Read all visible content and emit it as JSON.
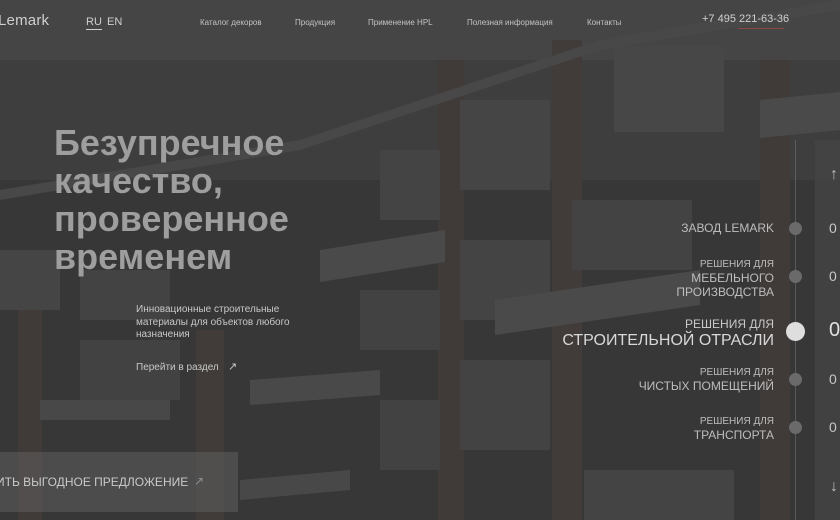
{
  "header": {
    "logo": "Lemark",
    "lang_active": "RU",
    "lang_other": "EN",
    "nav": [
      "Каталог декоров",
      "Продукция",
      "Применение HPL",
      "Полезная информация",
      "Контакты"
    ],
    "phone": "+7 495 221-63-36"
  },
  "hero": {
    "title_lines": [
      "Безупречное",
      "качество,",
      "проверенное",
      "временем"
    ],
    "subtitle_lines": [
      "Инновационные строительные",
      "материалы для объектов любого",
      "назначения"
    ],
    "link": "Перейти в раздел",
    "link_icon": "arrow-up-right-icon",
    "cta": "ИТЬ ВЫГОДНОЕ ПРЕДЛОЖЕНИЕ",
    "cta_icon": "arrow-up-right-icon"
  },
  "slider": {
    "arrow_up_icon": "arrow-up-icon",
    "arrow_down_icon": "arrow-down-icon",
    "items": [
      {
        "line1": "",
        "line2": "ЗАВОД LEMARK",
        "number": "0",
        "active": false
      },
      {
        "line1": "РЕШЕНИЯ ДЛЯ",
        "line2": "МЕБЕЛЬНОГО ПРОИЗВОДСТВА",
        "number": "0",
        "active": false
      },
      {
        "line1": "РЕШЕНИЯ ДЛЯ",
        "line2": "СТРОИТЕЛЬНОЙ ОТРАСЛИ",
        "number": "0",
        "active": true
      },
      {
        "line1": "РЕШЕНИЯ ДЛЯ",
        "line2": "ЧИСТЫХ ПОМЕЩЕНИЙ",
        "number": "0",
        "active": false
      },
      {
        "line1": "РЕШЕНИЯ ДЛЯ",
        "line2": "ТРАНСПОРТА",
        "number": "0",
        "active": false
      }
    ]
  },
  "colors": {
    "overlay": "#3b3b3b",
    "accent_underline": "#8a4a44",
    "active_dot": "#dedede"
  }
}
